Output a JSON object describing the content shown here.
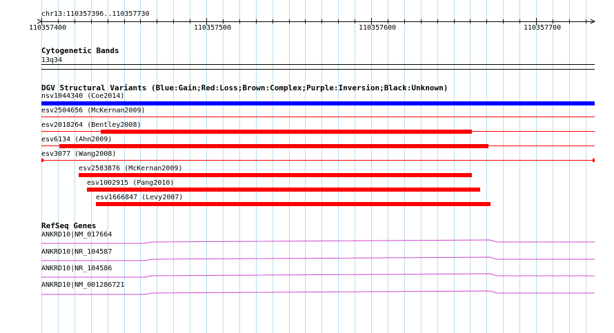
{
  "ruler": {
    "region_label": "chr13:110357396..110357730",
    "ticks": [
      "110357400",
      "110357500",
      "110357600",
      "110357700"
    ]
  },
  "cytogenetic_bands": {
    "title": "Cytogenetic Bands",
    "band_label": "13q34"
  },
  "dgv": {
    "title": "DGV Structural Variants (Blue:Gain;Red:Loss;Brown:Complex;Purple:Inversion;Black:Unknown)",
    "colors": {
      "gain": "#0000ff",
      "loss": "#ff0000"
    },
    "features": [
      {
        "label": "nsv1044340 (Coe2014)",
        "type": "gain"
      },
      {
        "label": "esv2504656 (McKernan2009)",
        "type": "loss"
      },
      {
        "label": "esv2018264 (Bentley2008)",
        "type": "loss"
      },
      {
        "label": "esv6134 (Ahn2009)",
        "type": "loss"
      },
      {
        "label": "esv3077 (Wang2008)",
        "type": "loss"
      },
      {
        "label": "esv2583876 (McKernan2009)",
        "type": "loss"
      },
      {
        "label": "esv1002915 (Pang2010)",
        "type": "loss"
      },
      {
        "label": "esv1666847 (Levy2007)",
        "type": "loss"
      }
    ]
  },
  "refseq": {
    "title": "RefSeq Genes",
    "color": "#cc44cc",
    "genes": [
      {
        "label": "ANKRD10|NM_017664"
      },
      {
        "label": "ANKRD10|NR_104587"
      },
      {
        "label": "ANKRD10|NR_104586"
      },
      {
        "label": "ANKRD10|NM_001286721"
      }
    ]
  }
}
